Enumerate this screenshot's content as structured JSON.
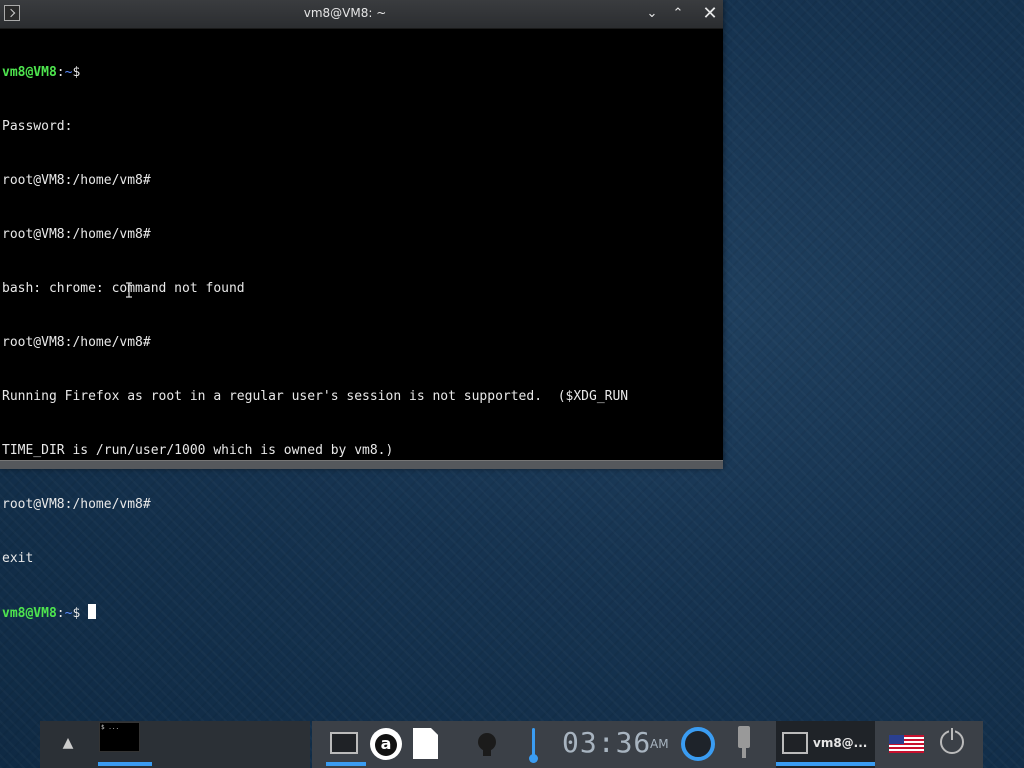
{
  "window": {
    "title": "vm8@VM8: ~",
    "buttons": {
      "minimize": "⌄",
      "maximize": "⌃",
      "close": "✕"
    }
  },
  "terminal": {
    "lines": [
      {
        "user": "vm8@VM8",
        "sep": ":",
        "path": "~",
        "suffix": "$",
        "text": ""
      },
      {
        "text": "Password:"
      },
      {
        "text": "root@VM8:/home/vm8#"
      },
      {
        "text": "root@VM8:/home/vm8#"
      },
      {
        "text": "bash: chrome: command not found"
      },
      {
        "text": "root@VM8:/home/vm8#"
      },
      {
        "text": "Running Firefox as root in a regular user's session is not supported.  ($XDG_RUN"
      },
      {
        "text": "TIME_DIR is /run/user/1000 which is owned by vm8.)"
      },
      {
        "text": "root@VM8:/home/vm8#"
      },
      {
        "text": "exit"
      }
    ],
    "current_prompt": {
      "user": "vm8@VM8",
      "sep": ":",
      "path": "~",
      "suffix": "$"
    }
  },
  "taskbar": {
    "thumbnail_text": "$ ...",
    "clock": "03:36",
    "ampm": "AM",
    "active_task_label": "vm8@...",
    "accent_color": "#3a9cf2",
    "icons": [
      "terminal-icon",
      "a-app-icon",
      "document-icon",
      "lightbulb-icon",
      "thermometer-icon",
      "ring-icon",
      "usb-icon",
      "us-flag-icon",
      "power-icon"
    ]
  }
}
